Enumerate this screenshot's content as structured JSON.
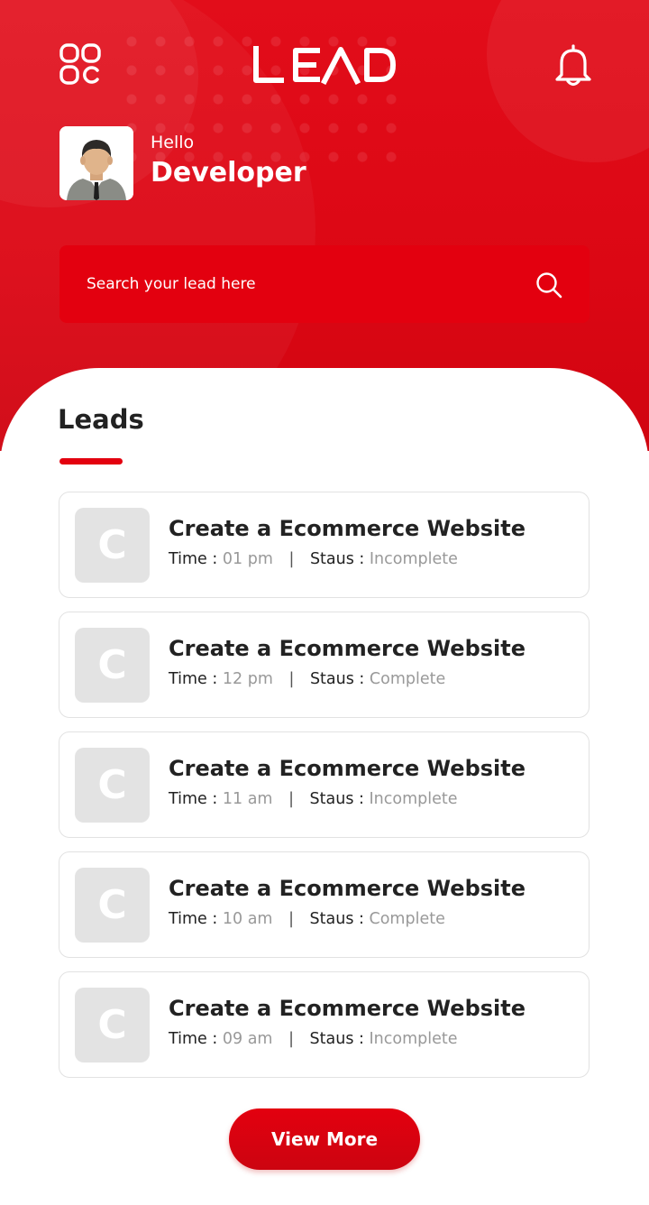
{
  "header": {
    "logo_text": "LEAD",
    "greeting": "Hello",
    "user_name": "Developer",
    "menu_icon": "grid-menu-icon",
    "notification_icon": "bell-icon"
  },
  "search": {
    "placeholder": "Search your lead here",
    "icon": "search-icon"
  },
  "leads_section": {
    "title": "Leads",
    "time_label": "Time :",
    "status_label": "Staus :",
    "separator": "|",
    "items": [
      {
        "letter": "C",
        "title": "Create a Ecommerce Website",
        "time": "01 pm",
        "status": "Incomplete"
      },
      {
        "letter": "C",
        "title": "Create a Ecommerce Website",
        "time": "12 pm",
        "status": "Complete"
      },
      {
        "letter": "C",
        "title": "Create a Ecommerce Website",
        "time": "11 am",
        "status": "Incomplete"
      },
      {
        "letter": "C",
        "title": "Create a Ecommerce Website",
        "time": "10 am",
        "status": "Complete"
      },
      {
        "letter": "C",
        "title": "Create a Ecommerce Website",
        "time": "09 am",
        "status": "Incomplete"
      }
    ]
  },
  "view_more_label": "View More",
  "colors": {
    "brand_red": "#e3000f",
    "card_border": "#e2e2e2",
    "placeholder_tile": "#e3e3e3",
    "muted_text": "#999999"
  }
}
